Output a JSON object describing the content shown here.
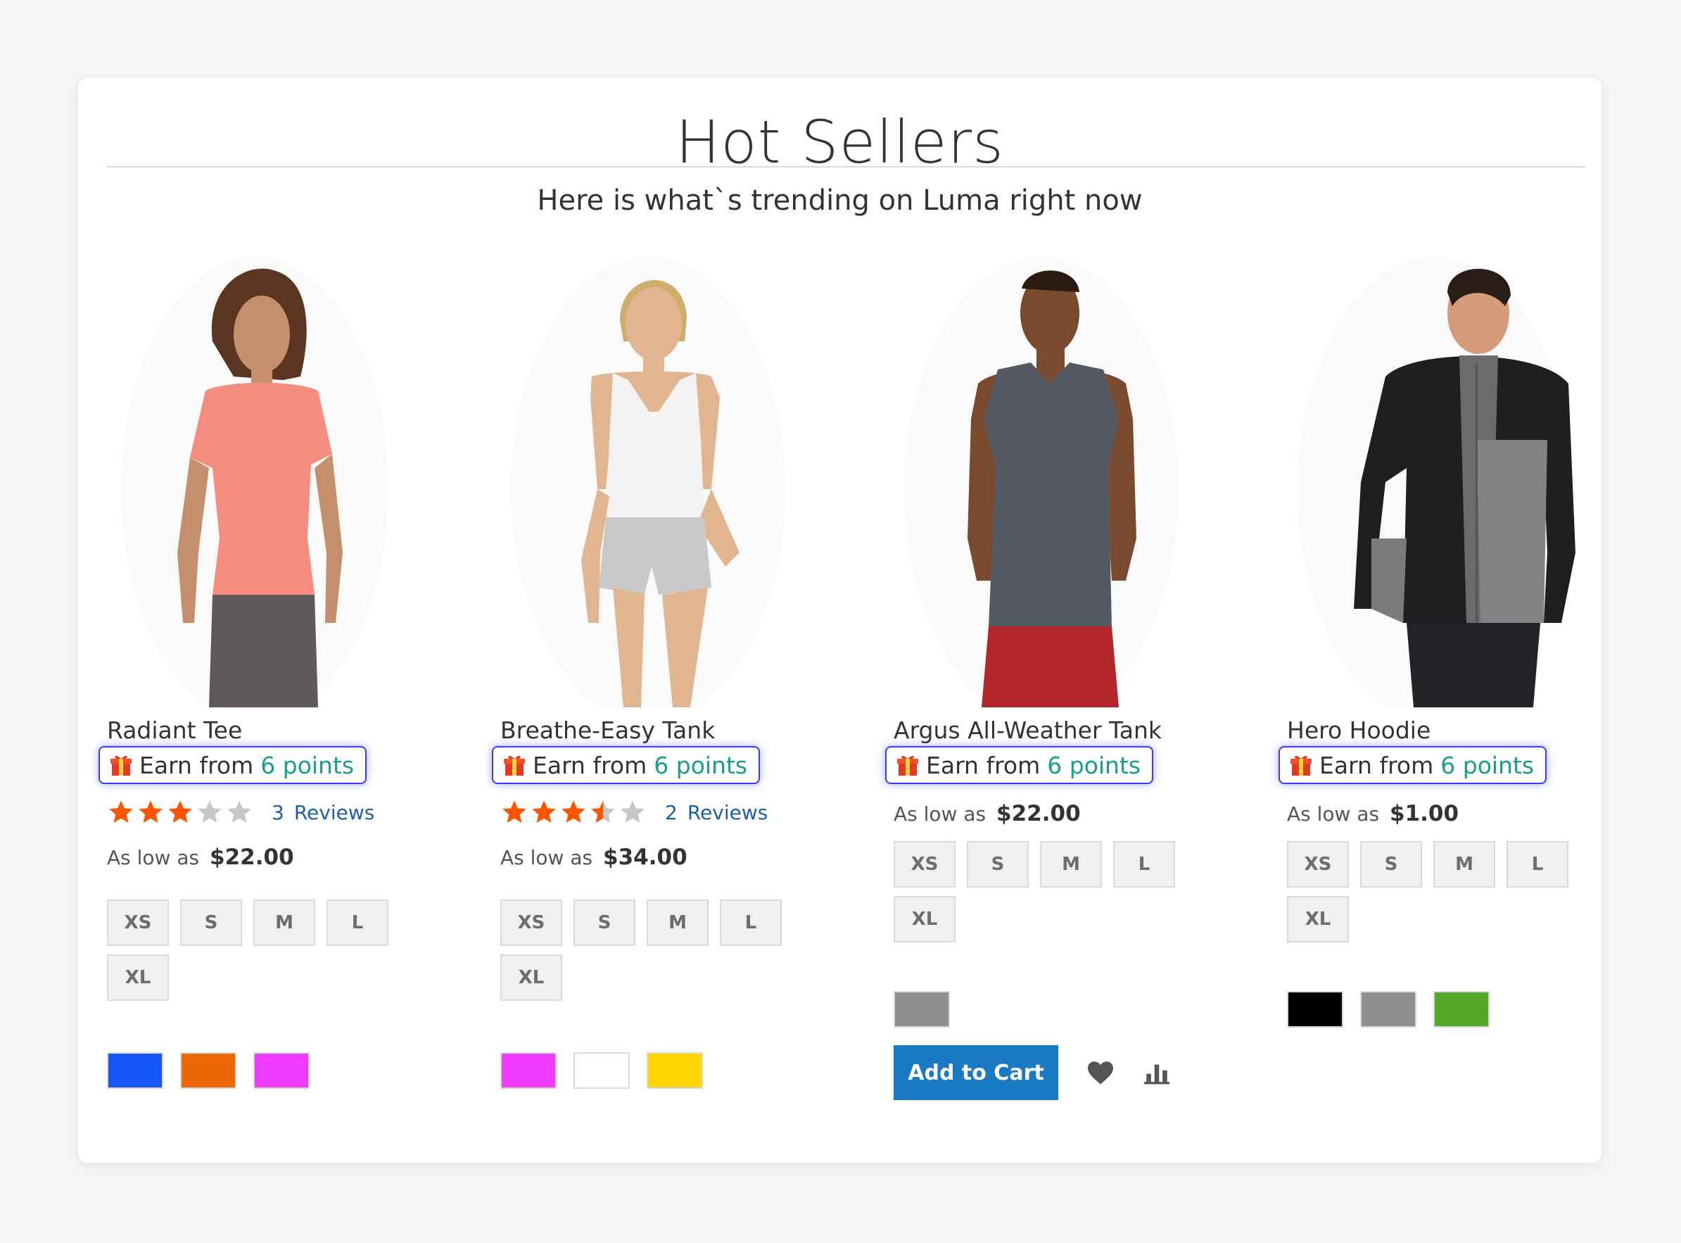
{
  "section": {
    "title": "Hot Sellers",
    "subtitle": "Here is what`s trending on Luma right now"
  },
  "colors": {
    "accent_blue": "#1979c3",
    "earn_border": "#3a3cf0",
    "points_teal": "#1a9e8c",
    "star_filled": "#ff5501",
    "star_empty": "#c7c7c7",
    "link": "#1c5fa8"
  },
  "products": [
    {
      "name": "Radiant Tee",
      "earn_label": "Earn from",
      "earn_points": "6 points",
      "rating_fraction": 0.6,
      "reviews_count": "3",
      "reviews_label": "Reviews",
      "price_label": "As low as",
      "price": "$22.00",
      "sizes": [
        "XS",
        "S",
        "M",
        "L",
        "XL"
      ],
      "swatches": [
        {
          "name": "swatch-blue",
          "color": "#1856f7"
        },
        {
          "name": "swatch-orange",
          "color": "#eb6703"
        },
        {
          "name": "swatch-pink",
          "color": "#ef3dff"
        }
      ],
      "image": "woman-in-pink-tee"
    },
    {
      "name": "Breathe-Easy Tank",
      "earn_label": "Earn from",
      "earn_points": "6 points",
      "rating_fraction": 0.7,
      "reviews_count": "2",
      "reviews_label": "Reviews",
      "price_label": "As low as",
      "price": "$34.00",
      "sizes": [
        "XS",
        "S",
        "M",
        "L",
        "XL"
      ],
      "swatches": [
        {
          "name": "swatch-pink",
          "color": "#ef3dff"
        },
        {
          "name": "swatch-white",
          "color": "#ffffff"
        },
        {
          "name": "swatch-yellow",
          "color": "#ffd500"
        }
      ],
      "image": "woman-in-white-tank"
    },
    {
      "name": "Argus All-Weather Tank",
      "earn_label": "Earn from",
      "earn_points": "6 points",
      "price_label": "As low as",
      "price": "$22.00",
      "sizes": [
        "XS",
        "S",
        "M",
        "L",
        "XL"
      ],
      "swatches": [
        {
          "name": "swatch-gray",
          "color": "#8f8f8f"
        }
      ],
      "add_to_cart_label": "Add to Cart",
      "image": "man-in-gray-tank"
    },
    {
      "name": "Hero Hoodie",
      "earn_label": "Earn from",
      "earn_points": "6 points",
      "price_label": "As low as",
      "price": "$1.00",
      "sizes": [
        "XS",
        "S",
        "M",
        "L",
        "XL"
      ],
      "swatches": [
        {
          "name": "swatch-black",
          "color": "#000000"
        },
        {
          "name": "swatch-gray",
          "color": "#8f8f8f"
        },
        {
          "name": "swatch-green",
          "color": "#53a828"
        }
      ],
      "image": "man-in-hoodie"
    }
  ]
}
